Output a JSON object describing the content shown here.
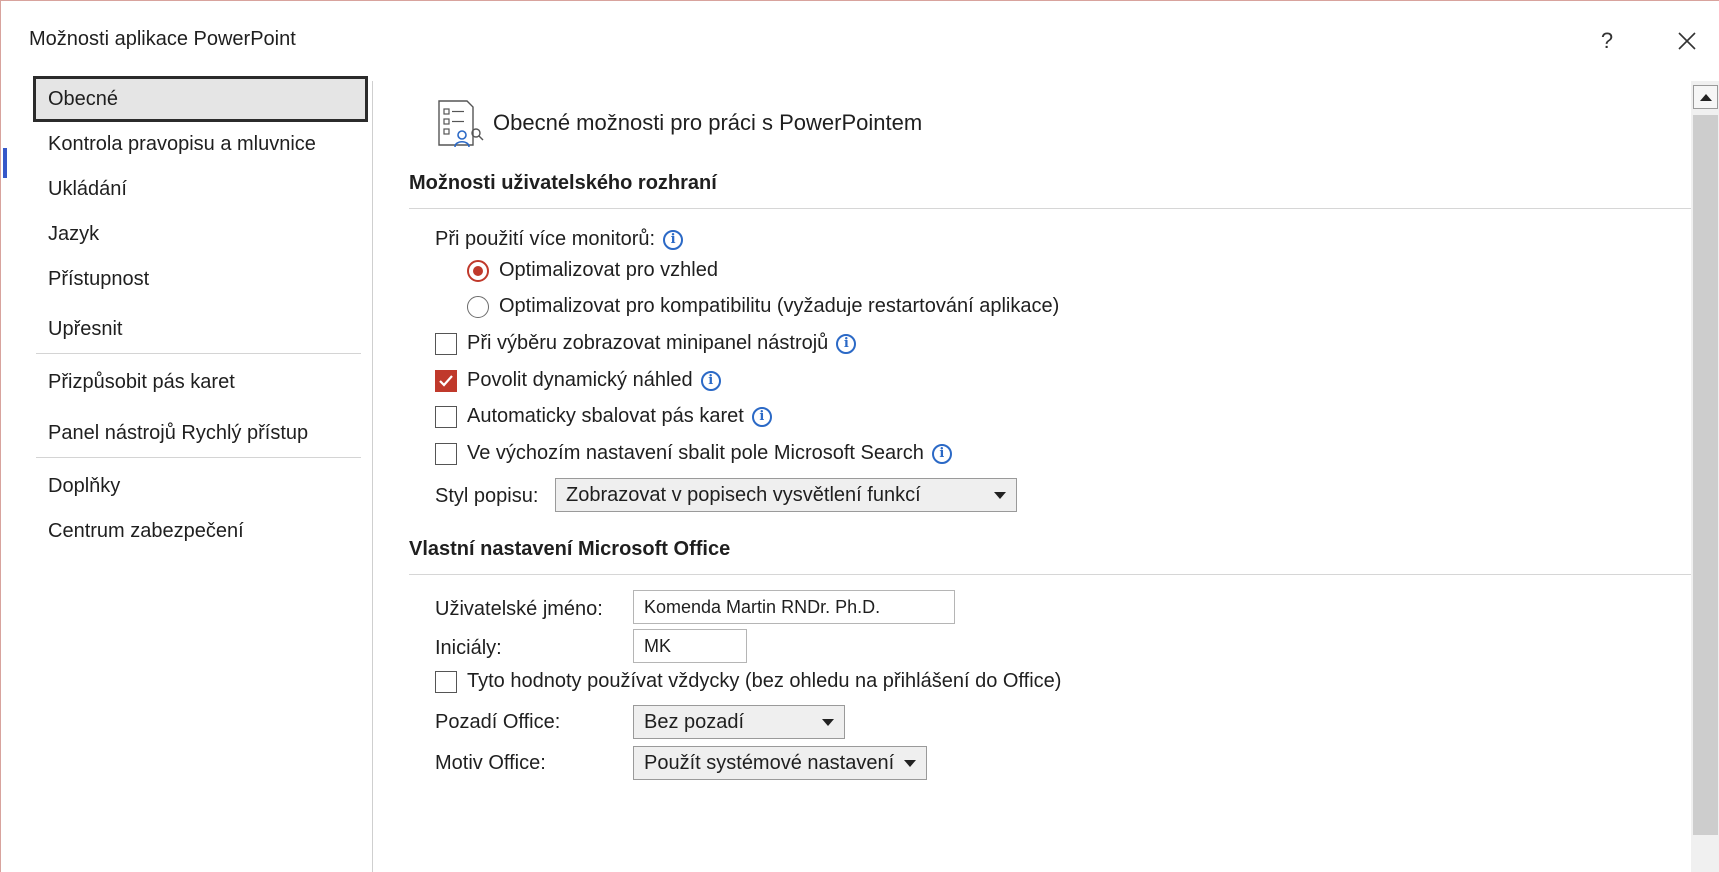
{
  "window": {
    "title": "Možnosti aplikace PowerPoint",
    "help_label": "?",
    "close_label": "✕"
  },
  "sidebar": {
    "items": [
      {
        "label": "Obecné",
        "selected": true
      },
      {
        "label": "Kontrola pravopisu a mluvnice"
      },
      {
        "label": "Ukládání"
      },
      {
        "label": "Jazyk"
      },
      {
        "label": "Přístupnost"
      },
      {
        "label": "Upřesnit"
      },
      {
        "label": "Přizpůsobit pás karet"
      },
      {
        "label": "Panel nástrojů Rychlý přístup"
      },
      {
        "label": "Doplňky"
      },
      {
        "label": "Centrum zabezpečení"
      }
    ]
  },
  "header": {
    "title": "Obecné možnosti pro práci s PowerPointem",
    "icon": "general-options-icon"
  },
  "ui_options": {
    "section_title": "Možnosti uživatelského rozhraní",
    "multi_monitor_label": "Při použití více monitorů:",
    "radio_appearance": "Optimalizovat pro vzhled",
    "radio_compat": "Optimalizovat pro kompatibilitu (vyžaduje restartování aplikace)",
    "radio_selected": "appearance",
    "cb_minitoolbar": {
      "label": "Při výběru zobrazovat minipanel nástrojů",
      "checked": false
    },
    "cb_live_preview": {
      "label": "Povolit dynamický náhled",
      "checked": true
    },
    "cb_collapse_ribbon": {
      "label": "Automaticky sbalovat pás karet",
      "checked": false
    },
    "cb_collapse_search": {
      "label": "Ve výchozím nastavení sbalit pole Microsoft Search",
      "checked": false
    },
    "tooltip_style_label": "Styl popisu:",
    "tooltip_style_value": "Zobrazovat v popisech vysvětlení funkcí"
  },
  "office_personalize": {
    "section_title": "Vlastní nastavení Microsoft Office",
    "username_label": "Uživatelské jméno:",
    "username_value": "Komenda Martin RNDr. Ph.D.",
    "initials_label": "Iniciály:",
    "initials_value": "MK",
    "cb_always_use": {
      "label": "Tyto hodnoty používat vždycky (bez ohledu na přihlášení do Office)",
      "checked": false
    },
    "background_label": "Pozadí Office:",
    "background_value": "Bez pozadí",
    "theme_label": "Motiv Office:",
    "theme_value": "Použít systémové nastavení"
  },
  "colors": {
    "accent": "#c0392b",
    "info": "#2b69c6"
  }
}
